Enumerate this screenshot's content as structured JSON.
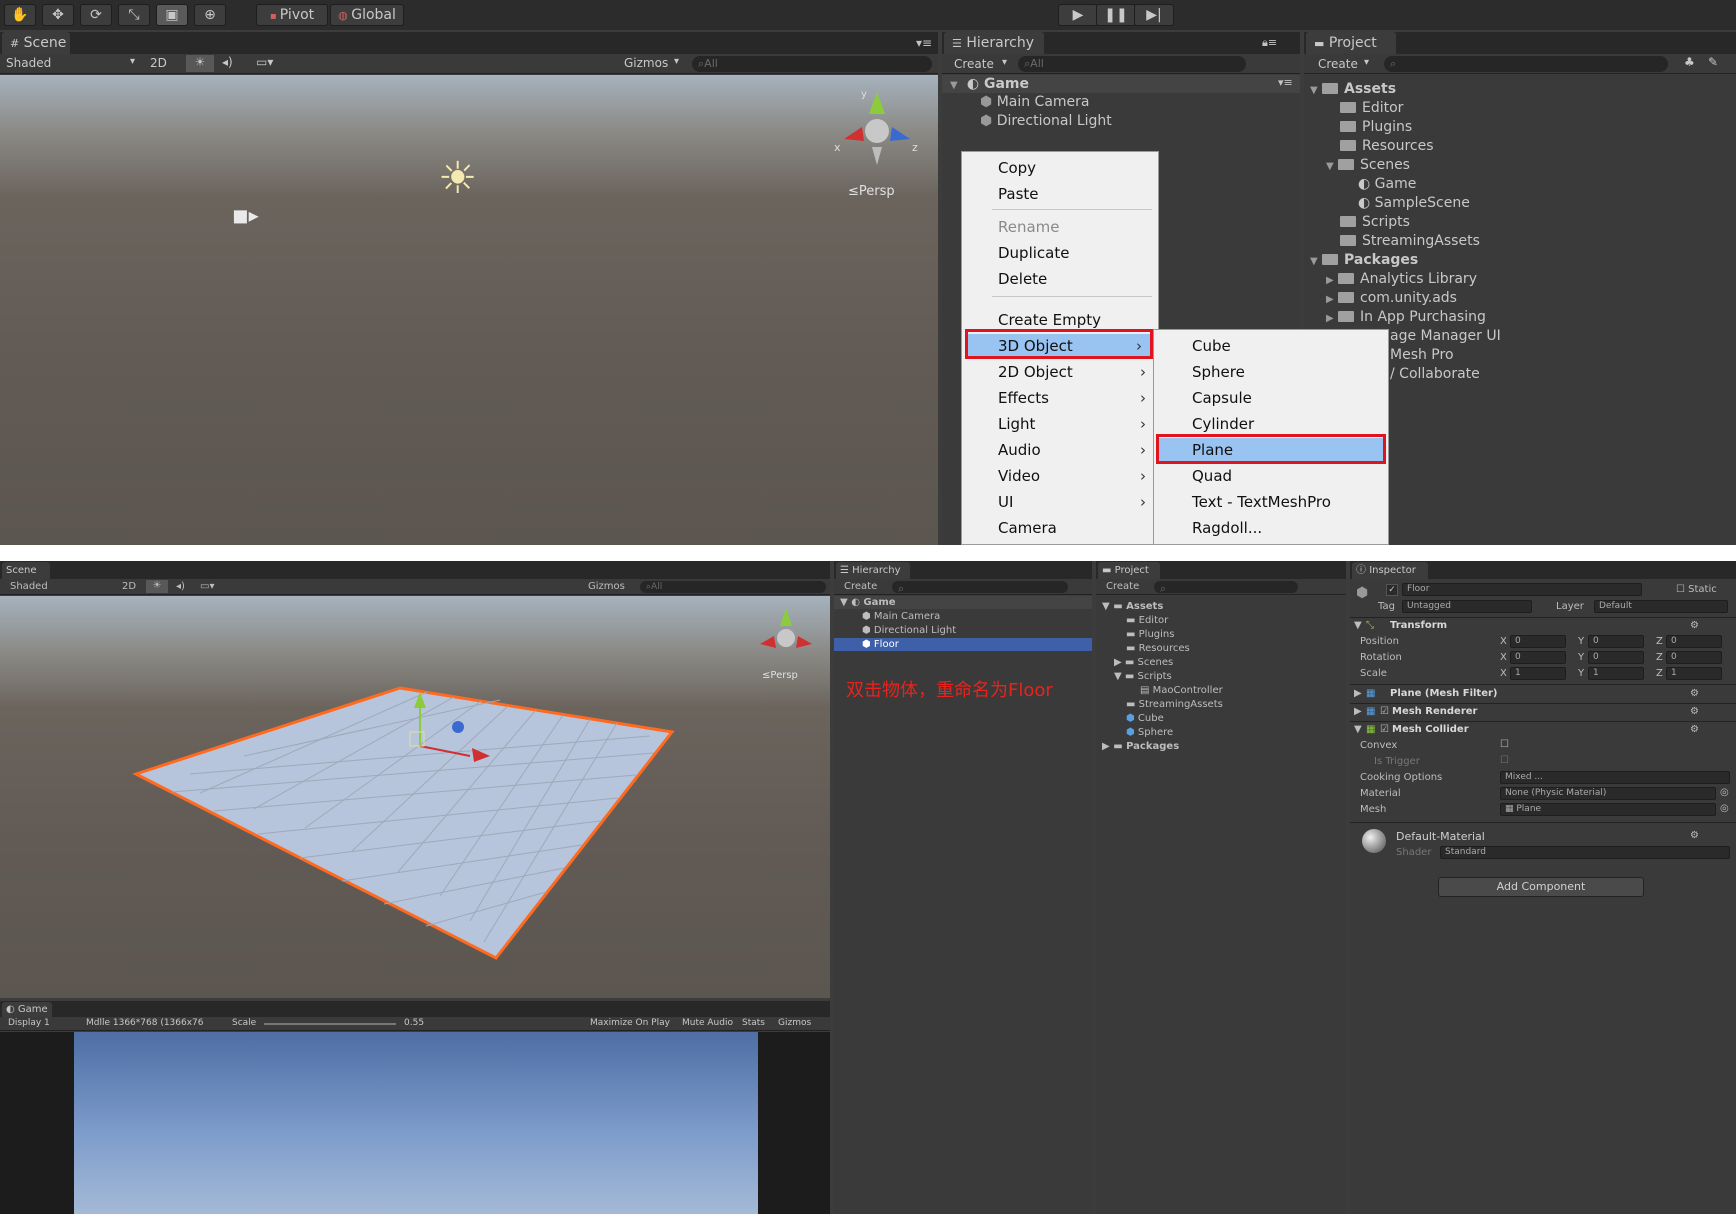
{
  "toolbar": {
    "tools": [
      "hand-icon",
      "move-icon",
      "rotate-icon",
      "scale-icon",
      "rect-icon",
      "transform-icon"
    ],
    "pivot_label": "Pivot",
    "global_label": "Global"
  },
  "scene_panel": {
    "tab_label": "Scene",
    "shading": "Shaded",
    "mode_2d": "2D",
    "gizmos": "Gizmos",
    "search_placeholder": "All",
    "persp_label": "Persp",
    "axis_x": "x",
    "axis_y": "y",
    "axis_z": "z"
  },
  "hierarchy_panel": {
    "tab_label": "Hierarchy",
    "create": "Create",
    "search_placeholder": "All",
    "scene_name": "Game",
    "items": [
      "Main Camera",
      "Directional Light"
    ]
  },
  "context_menu": {
    "items": [
      {
        "label": "Copy",
        "disabled": false
      },
      {
        "label": "Paste",
        "disabled": false
      },
      {
        "label": "Rename",
        "disabled": true
      },
      {
        "label": "Duplicate",
        "disabled": false
      },
      {
        "label": "Delete",
        "disabled": false
      },
      {
        "label": "Create Empty",
        "disabled": false
      },
      {
        "label": "3D Object",
        "disabled": false
      },
      {
        "label": "2D Object",
        "disabled": false
      },
      {
        "label": "Effects",
        "disabled": false
      },
      {
        "label": "Light",
        "disabled": false
      },
      {
        "label": "Audio",
        "disabled": false
      },
      {
        "label": "Video",
        "disabled": false
      },
      {
        "label": "UI",
        "disabled": false
      },
      {
        "label": "Camera",
        "disabled": false
      }
    ],
    "submenu_items": [
      "Cube",
      "Sphere",
      "Capsule",
      "Cylinder",
      "Plane",
      "Quad",
      "Text - TextMeshPro",
      "Ragdoll..."
    ]
  },
  "project_panel": {
    "tab_label": "Project",
    "create": "Create",
    "assets_label": "Assets",
    "assets": [
      "Editor",
      "Plugins",
      "Resources",
      "Scenes",
      "Scripts",
      "StreamingAssets"
    ],
    "scenes": [
      "Game",
      "SampleScene"
    ],
    "packages_label": "Packages",
    "packages": [
      "Analytics Library",
      "com.unity.ads",
      "In App Purchasing",
      "age Manager UI",
      "Mesh Pro",
      "/ Collaborate"
    ]
  },
  "bottom": {
    "scene_tab": "Scene",
    "shading": "Shaded",
    "mode_2d": "2D",
    "gizmos": "Gizmos",
    "search": "All",
    "persp": "Persp",
    "hierarchy_tab": "Hierarchy",
    "create": "Create",
    "scene_name": "Game",
    "hierarchy_items": [
      "Main Camera",
      "Directional Light",
      "Floor"
    ],
    "annotation": "双击物体，重命名为Floor",
    "project_tab": "Project",
    "assets_label": "Assets",
    "assets": [
      "Editor",
      "Plugins",
      "Resources",
      "Scenes",
      "Scripts",
      "MaoController",
      "StreamingAssets",
      "Cube",
      "Sphere"
    ],
    "packages_label": "Packages",
    "inspector_tab": "Inspector",
    "object_name": "Floor",
    "static_label": "Static",
    "tag_label": "Tag",
    "tag_value": "Untagged",
    "layer_label": "Layer",
    "layer_value": "Default",
    "transform_label": "Transform",
    "position_label": "Position",
    "rotation_label": "Rotation",
    "scale_label": "Scale",
    "position": [
      "0",
      "0",
      "0"
    ],
    "rotation": [
      "0",
      "0",
      "0"
    ],
    "scale": [
      "1",
      "1",
      "1"
    ],
    "axis_x": "X",
    "axis_y": "Y",
    "axis_z": "Z",
    "mesh_filter": "Plane (Mesh Filter)",
    "mesh_renderer": "Mesh Renderer",
    "mesh_collider": "Mesh Collider",
    "convex": "Convex",
    "is_trigger": "Is Trigger",
    "cooking_options": "Cooking Options",
    "cooking_value": "Mixed ...",
    "material_label": "Material",
    "material_value": "None (Physic Material)",
    "mesh_label": "Mesh",
    "mesh_value": "Plane",
    "default_material": "Default-Material",
    "shader_label": "Shader",
    "shader_value": "Standard",
    "add_component": "Add Component",
    "game_tab": "Game",
    "display": "Display 1",
    "resolution": "Mdlle 1366*768 (1366x76",
    "scale_text": "Scale",
    "scale_value": "0.55",
    "maximize": "Maximize On Play",
    "mute": "Mute Audio",
    "stats": "Stats",
    "game_gizmos": "Gizmos"
  }
}
